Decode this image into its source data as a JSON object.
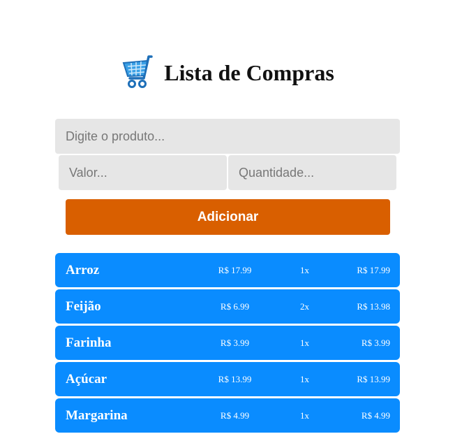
{
  "header": {
    "title": "Lista de Compras",
    "icon": "shopping-cart-icon"
  },
  "form": {
    "produto_placeholder": "Digite o produto...",
    "valor_placeholder": "Valor...",
    "quantidade_placeholder": "Quantidade...",
    "add_label": "Adicionar"
  },
  "colors": {
    "accent": "#d95f00",
    "item_background": "#0a8cff",
    "input_background": "#e6e6e6"
  },
  "items": [
    {
      "name": "Arroz",
      "price": "R$ 17.99",
      "qty": "1x",
      "total": "R$ 17.99"
    },
    {
      "name": "Feijão",
      "price": "R$ 6.99",
      "qty": "2x",
      "total": "R$ 13.98"
    },
    {
      "name": "Farinha",
      "price": "R$ 3.99",
      "qty": "1x",
      "total": "R$ 3.99"
    },
    {
      "name": "Açúcar",
      "price": "R$ 13.99",
      "qty": "1x",
      "total": "R$ 13.99"
    },
    {
      "name": "Margarina",
      "price": "R$ 4.99",
      "qty": "1x",
      "total": "R$ 4.99"
    }
  ]
}
